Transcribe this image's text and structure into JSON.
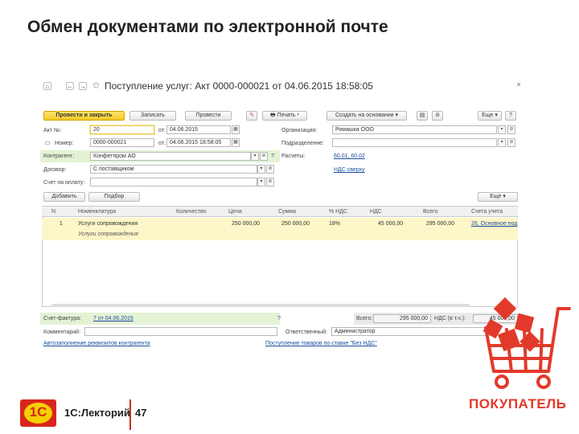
{
  "slide": {
    "title": "Обмен документами по электронной почте",
    "footer_brand": "1С:Лекторий",
    "page_number": "47",
    "logo_text": "1С",
    "buyer_label": "ПОКУПАТЕЛЬ"
  },
  "window": {
    "title": "Поступление услуг: Акт 0000-000021 от 04.06.2015 18:58:05",
    "close_glyph": "×",
    "nav_glyphs": {
      "home": "⌂",
      "back": "←",
      "forward": "→",
      "star": "☆"
    }
  },
  "toolbar": {
    "post_close": "Провести и закрыть",
    "save": "Записать",
    "post": "Провести",
    "print": "Печать",
    "create_based": "Создать на основании",
    "more": "Еще",
    "help": "?"
  },
  "form": {
    "act_no_label": "Акт №:",
    "act_no_value": "20",
    "act_date_label": "от:",
    "act_date_value": "04.06.2015",
    "number_label": "Номер:",
    "number_value": "0000-000021",
    "number_date_label": "от:",
    "number_date_value": "04.06.2015 18:58:05",
    "org_label": "Организация:",
    "org_value": "Ромашка ООО",
    "dept_label": "Подразделение:",
    "dept_value": "",
    "counterparty_label": "Контрагент:",
    "counterparty_value": "Конфетпром АО",
    "counterparty_help": "?",
    "contract_label": "Договор:",
    "contract_value": "С поставщиком",
    "invoice_label": "Счет на оплату:",
    "invoice_value": "",
    "settlements_label": "Расчеты:",
    "settlements_value": "60.01, 60.02",
    "vat_link": "НДС сверху"
  },
  "table_toolbar": {
    "add": "Добавить",
    "pick": "Подбор",
    "more": "Еще"
  },
  "table": {
    "columns": [
      "N",
      "Номенклатура",
      "Количество",
      "Цена",
      "Сумма",
      "% НДС",
      "НДС",
      "Всего",
      "Счета учета"
    ],
    "rows": [
      {
        "n": "1",
        "item": "Услуги сопровождения",
        "item_desc": "Услуги сопровождения",
        "qty": "",
        "price": "250 000,00",
        "sum": "250 000,00",
        "vat_rate": "18%",
        "vat": "45 000,00",
        "total": "295 000,00",
        "accounts": "26, Основное под"
      }
    ]
  },
  "footer": {
    "invoice_label": "Счет-фактура:",
    "invoice_value": "7 от 04.06.2015",
    "invoice_help": "?",
    "total_label": "Всего:",
    "total_value": "295 000,00",
    "vat_incl_label": "НДС (в т.ч.):",
    "vat_incl_value": "45 000,00",
    "comment_label": "Комментарий:",
    "comment_value": "",
    "responsible_label": "Ответственный:",
    "responsible_value": "Администратор",
    "autofill_link": "Автозаполнение реквизитов контрагента",
    "no_vat_link": "Поступление товаров по ставке \"Без НДС\""
  },
  "colors": {
    "accent_red": "#e23a2a",
    "button_yellow": "#f4c92a",
    "row_highlight": "#fdf6c8",
    "green_band": "#e4f2d4",
    "link_blue": "#1b4fa0"
  }
}
